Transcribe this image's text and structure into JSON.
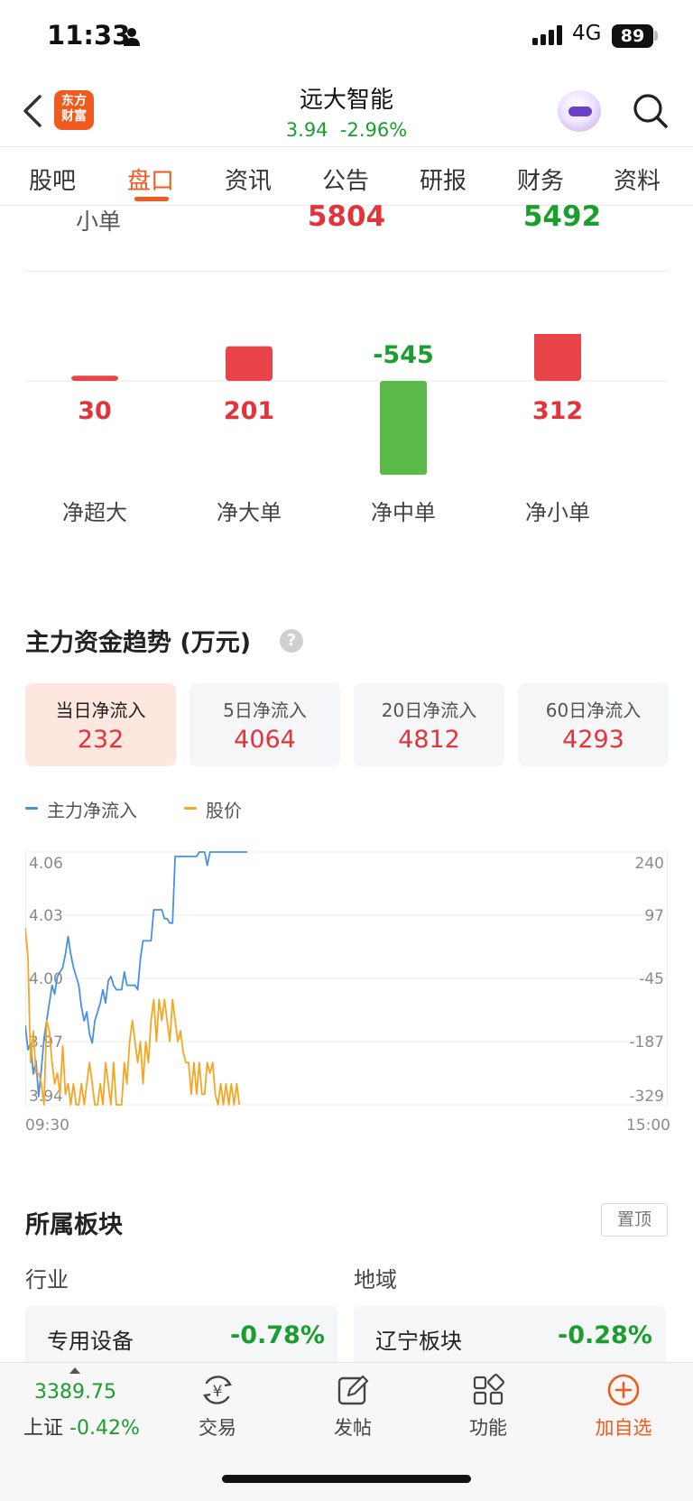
{
  "status_bar": {
    "time": "11:33",
    "network": "4G",
    "battery": "89"
  },
  "header": {
    "logo_text": "东方财富",
    "stock_name": "远大智能",
    "price": "3.94",
    "change_pct": "-2.96%"
  },
  "tabs": [
    {
      "label": "股吧",
      "active": false
    },
    {
      "label": "盘口",
      "active": true
    },
    {
      "label": "资讯",
      "active": false
    },
    {
      "label": "公告",
      "active": false
    },
    {
      "label": "研报",
      "active": false
    },
    {
      "label": "财务",
      "active": false
    },
    {
      "label": "资料",
      "active": false
    }
  ],
  "small_order_row": {
    "label": "小单",
    "inflow": "5804",
    "outflow": "5492"
  },
  "net_flow_bars": {
    "items": [
      {
        "label": "净超大",
        "value": 30
      },
      {
        "label": "净大单",
        "value": 201
      },
      {
        "label": "净中单",
        "value": -545
      },
      {
        "label": "净小单",
        "value": 312
      }
    ],
    "colors": {
      "positive": "#e8444a",
      "negative": "#5bba47",
      "positive_text": "#e3343c",
      "negative_text": "#1a9e2e"
    }
  },
  "trend": {
    "title": "主力资金趋势 (万元)",
    "help_icon": "?",
    "cards": [
      {
        "label": "当日净流入",
        "value": "232",
        "active": true
      },
      {
        "label": "5日净流入",
        "value": "4064",
        "active": false
      },
      {
        "label": "20日净流入",
        "value": "4812",
        "active": false
      },
      {
        "label": "60日净流入",
        "value": "4293",
        "active": false
      }
    ],
    "legend": [
      {
        "name": "主力净流入",
        "color": "#4a90e2"
      },
      {
        "name": "股价",
        "color": "#f5a623"
      }
    ]
  },
  "chart_data": {
    "type": "line",
    "x_start_label": "09:30",
    "x_end_label": "15:00",
    "left_axis_ticks": [
      "4.06",
      "4.03",
      "4.00",
      "3.97",
      "3.94"
    ],
    "right_axis_ticks": [
      "240",
      "97",
      "-45",
      "-187",
      "-329"
    ],
    "left_axis_range": [
      3.94,
      4.06
    ],
    "right_axis_range": [
      -329,
      240
    ],
    "grid": true,
    "series": [
      {
        "name": "主力净流入",
        "axis": "right",
        "color": "#4a90e2",
        "values": [
          -150,
          -205,
          -190,
          -260,
          -230,
          -310,
          -250,
          -180,
          -140,
          -100,
          -60,
          -80,
          -40,
          -30,
          -20,
          10,
          50,
          10,
          -20,
          -40,
          -60,
          -110,
          -140,
          -120,
          -170,
          -190,
          -140,
          -120,
          -100,
          -70,
          -100,
          -50,
          -40,
          -60,
          -70,
          -70,
          -70,
          -30,
          -60,
          -60,
          -60,
          -60,
          -70,
          0,
          40,
          40,
          40,
          40,
          110,
          110,
          110,
          110,
          90,
          90,
          80,
          80,
          230,
          230,
          230,
          230,
          230,
          230,
          230,
          230,
          230,
          260,
          260,
          260,
          210,
          260,
          260,
          260,
          260,
          260,
          280,
          280,
          280,
          280,
          280,
          260,
          260,
          260,
          260,
          280
        ]
      },
      {
        "name": "股价",
        "axis": "left",
        "color": "#f5a623",
        "values": [
          4.024,
          4.01,
          3.96,
          3.975,
          3.955,
          3.955,
          3.95,
          3.93,
          3.98,
          3.975,
          3.96,
          3.95,
          3.955,
          3.945,
          3.968,
          3.945,
          3.95,
          3.94,
          3.95,
          3.94,
          3.94,
          3.95,
          3.94,
          3.95,
          3.96,
          3.95,
          3.94,
          3.94,
          3.95,
          3.94,
          3.96,
          3.95,
          3.94,
          3.96,
          3.94,
          3.94,
          3.94,
          3.96,
          3.95,
          3.97,
          3.98,
          3.97,
          3.96,
          3.97,
          3.95,
          3.97,
          3.96,
          3.98,
          3.99,
          3.97,
          3.99,
          3.98,
          3.99,
          3.98,
          3.97,
          3.99,
          3.98,
          3.97,
          3.975,
          3.965,
          3.96,
          3.96,
          3.945,
          3.96,
          3.945,
          3.96,
          3.945,
          3.945,
          3.96,
          3.955,
          3.96,
          3.945,
          3.94,
          3.95,
          3.94,
          3.95,
          3.94,
          3.95,
          3.94,
          3.95,
          3.94
        ]
      }
    ]
  },
  "sectors": {
    "title": "所属板块",
    "pin_label": "置顶",
    "industry": {
      "category": "行业",
      "name": "专用设备",
      "change": "-0.78%"
    },
    "region": {
      "category": "地域",
      "name": "辽宁板块",
      "change": "-0.28%"
    }
  },
  "bottom_bar": {
    "index_value": "3389.75",
    "index_name": "上证",
    "index_change": "-0.42%",
    "items": [
      {
        "label": "交易",
        "icon": "trade-yen-icon"
      },
      {
        "label": "发帖",
        "icon": "compose-icon"
      },
      {
        "label": "功能",
        "icon": "apps-grid-icon"
      },
      {
        "label": "加自选",
        "icon": "add-watchlist-icon"
      }
    ],
    "accent_color": "#ef5a1e"
  }
}
